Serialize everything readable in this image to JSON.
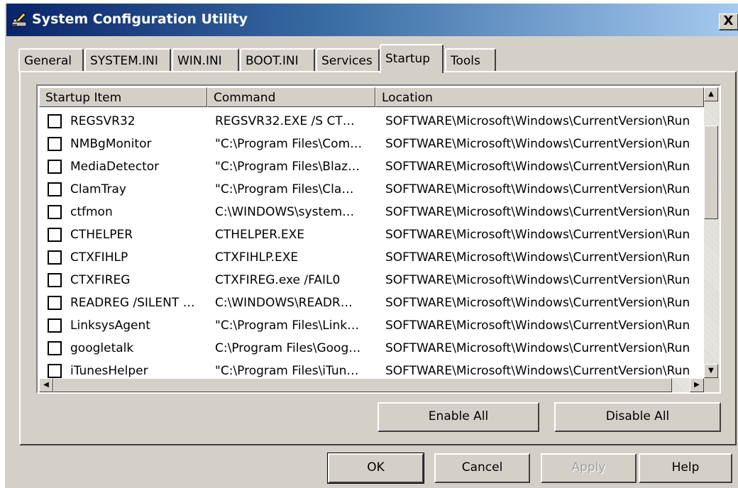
{
  "window": {
    "title": "System Configuration Utility",
    "close_label": "X"
  },
  "tabs": [
    {
      "label": "General"
    },
    {
      "label": "SYSTEM.INI"
    },
    {
      "label": "WIN.INI"
    },
    {
      "label": "BOOT.INI"
    },
    {
      "label": "Services"
    },
    {
      "label": "Startup",
      "active": true
    },
    {
      "label": "Tools"
    }
  ],
  "startup": {
    "columns": [
      "Startup Item",
      "Command",
      "Location"
    ],
    "rows": [
      {
        "item": "REGSVR32",
        "command": "REGSVR32.EXE /S CT…",
        "location": "SOFTWARE\\Microsoft\\Windows\\CurrentVersion\\Run",
        "checked": false
      },
      {
        "item": "NMBgMonitor",
        "command": "\"C:\\Program Files\\Com…",
        "location": "SOFTWARE\\Microsoft\\Windows\\CurrentVersion\\Run",
        "checked": false
      },
      {
        "item": "MediaDetector",
        "command": "\"C:\\Program Files\\Blaz…",
        "location": "SOFTWARE\\Microsoft\\Windows\\CurrentVersion\\Run",
        "checked": false
      },
      {
        "item": "ClamTray",
        "command": "\"C:\\Program Files\\Cla…",
        "location": "SOFTWARE\\Microsoft\\Windows\\CurrentVersion\\Run",
        "checked": false
      },
      {
        "item": "ctfmon",
        "command": "C:\\WINDOWS\\system…",
        "location": "SOFTWARE\\Microsoft\\Windows\\CurrentVersion\\Run",
        "checked": false
      },
      {
        "item": "CTHELPER",
        "command": "CTHELPER.EXE",
        "location": "SOFTWARE\\Microsoft\\Windows\\CurrentVersion\\Run",
        "checked": false
      },
      {
        "item": "CTXFIHLP",
        "command": "CTXFIHLP.EXE",
        "location": "SOFTWARE\\Microsoft\\Windows\\CurrentVersion\\Run",
        "checked": false
      },
      {
        "item": "CTXFIREG",
        "command": "CTXFIREG.exe /FAIL0",
        "location": "SOFTWARE\\Microsoft\\Windows\\CurrentVersion\\Run",
        "checked": false
      },
      {
        "item": "READREG /SILENT …",
        "command": "C:\\WINDOWS\\READR…",
        "location": "SOFTWARE\\Microsoft\\Windows\\CurrentVersion\\Run",
        "checked": false
      },
      {
        "item": "LinksysAgent",
        "command": "\"C:\\Program Files\\Link…",
        "location": "SOFTWARE\\Microsoft\\Windows\\CurrentVersion\\Run",
        "checked": false
      },
      {
        "item": "googletalk",
        "command": "C:\\Program Files\\Goog…",
        "location": "SOFTWARE\\Microsoft\\Windows\\CurrentVersion\\Run",
        "checked": false
      },
      {
        "item": "iTunesHelper",
        "command": "\"C:\\Program Files\\iTun…",
        "location": "SOFTWARE\\Microsoft\\Windows\\CurrentVersion\\Run",
        "checked": false
      }
    ],
    "enable_all_label": "Enable All",
    "disable_all_label": "Disable All"
  },
  "footer": {
    "ok_label": "OK",
    "cancel_label": "Cancel",
    "apply_label": "Apply",
    "help_label": "Help"
  },
  "icons": {
    "title": "msconfig-icon",
    "scroll_up": "arrow-up-icon",
    "scroll_down": "arrow-down-icon",
    "scroll_left": "arrow-left-icon",
    "scroll_right": "arrow-right-icon"
  },
  "colors": {
    "titlebar_start": "#0a246a",
    "titlebar_end": "#a6caf0",
    "face": "#d4d0c8"
  }
}
